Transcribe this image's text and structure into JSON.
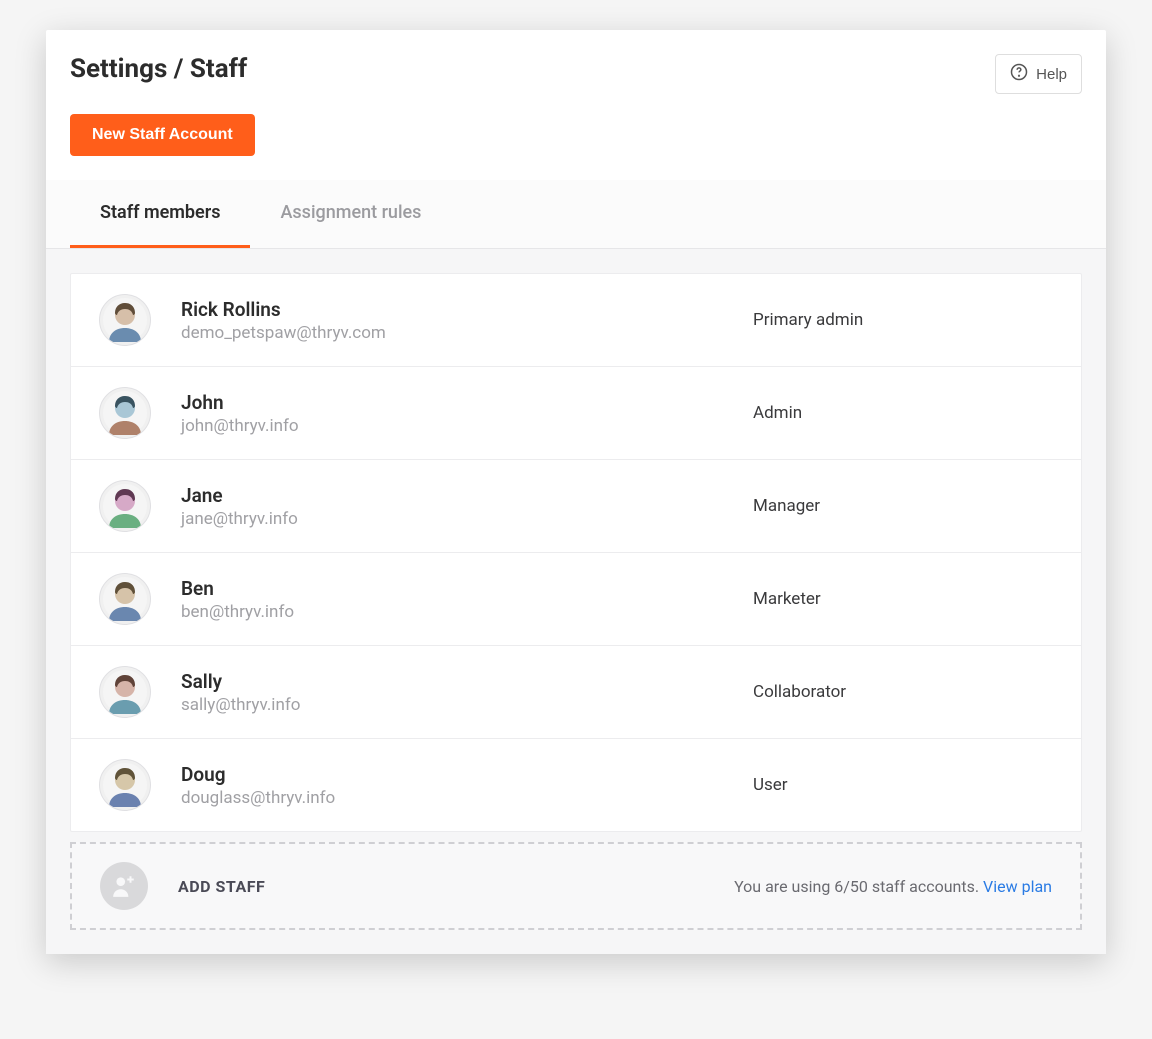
{
  "breadcrumb": "Settings / Staff",
  "help_label": "Help",
  "new_staff_label": "New Staff Account",
  "tabs": [
    {
      "label": "Staff members",
      "active": true
    },
    {
      "label": "Assignment rules",
      "active": false
    }
  ],
  "staff": [
    {
      "name": "Rick Rollins",
      "email": "demo_petspaw@thryv.com",
      "role": "Primary admin",
      "avatar_hue": 30
    },
    {
      "name": "John",
      "email": "john@thryv.info",
      "role": "Admin",
      "avatar_hue": 200
    },
    {
      "name": "Jane",
      "email": "jane@thryv.info",
      "role": "Manager",
      "avatar_hue": 320
    },
    {
      "name": "Ben",
      "email": "ben@thryv.info",
      "role": "Marketer",
      "avatar_hue": 35
    },
    {
      "name": "Sally",
      "email": "sally@thryv.info",
      "role": "Collaborator",
      "avatar_hue": 15
    },
    {
      "name": "Doug",
      "email": "douglass@thryv.info",
      "role": "User",
      "avatar_hue": 40
    }
  ],
  "add_staff_label": "ADD STAFF",
  "usage_text": "You are using 6/50 staff accounts. ",
  "view_plan_label": "View plan"
}
